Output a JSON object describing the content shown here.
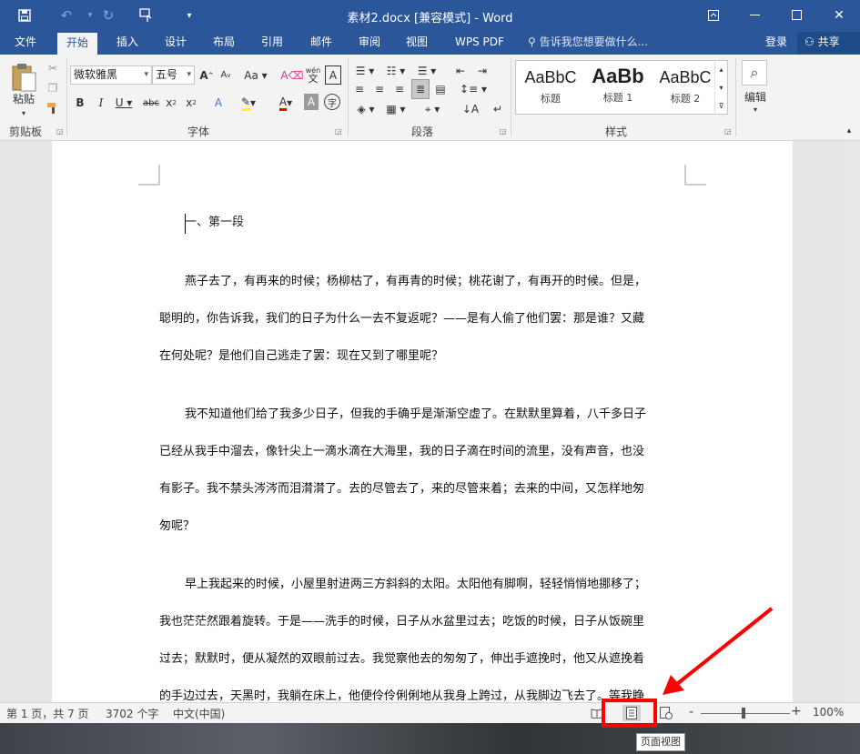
{
  "window": {
    "title": "素材2.docx [兼容模式] - Word"
  },
  "tabs": [
    "文件",
    "开始",
    "插入",
    "设计",
    "布局",
    "引用",
    "邮件",
    "审阅",
    "视图",
    "WPS PDF"
  ],
  "tell_me": "告诉我您想要做什么...",
  "account": {
    "login": "登录",
    "share": "共享"
  },
  "ribbon": {
    "clipboard": {
      "paste": "粘贴",
      "label": "剪贴板"
    },
    "font": {
      "name": "微软雅黑",
      "size": "五号",
      "label": "字体",
      "wen": "wén",
      "A": "A"
    },
    "paragraph": {
      "label": "段落"
    },
    "styles": {
      "label": "样式",
      "items": [
        {
          "sample": "AaBbC",
          "name": "标题"
        },
        {
          "sample": "AaBb",
          "name": "标题 1"
        },
        {
          "sample": "AaBbC",
          "name": "标题 2"
        }
      ]
    },
    "editing": {
      "label": "编辑"
    }
  },
  "document": {
    "heading": "一、第一段",
    "paragraphs": [
      [
        "燕子去了，有再来的时候；杨柳枯了，有再青的时候；桃花谢了，有再开的时候。但是，",
        "聪明的，你告诉我，我们的日子为什么一去不复返呢？——是有人偷了他们罢：那是谁？又藏",
        "在何处呢？是他们自己逃走了罢：现在又到了哪里呢？"
      ],
      [
        "我不知道他们给了我多少日子，但我的手确乎是渐渐空虚了。在默默里算着，八千多日子",
        "已经从我手中溜去，像针尖上一滴水滴在大海里，我的日子滴在时间的流里，没有声音，也没",
        "有影子。我不禁头涔涔而泪潸潸了。去的尽管去了，来的尽管来着；去来的中间，又怎样地匆",
        "匆呢？"
      ],
      [
        "早上我起来的时候，小屋里射进两三方斜斜的太阳。太阳他有脚啊，轻轻悄悄地挪移了；",
        "我也茫茫然跟着旋转。于是——洗手的时候，日子从水盆里过去；吃饭的时候，日子从饭碗里",
        "过去；默默时，便从凝然的双眼前过去。我觉察他去的匆匆了，伸出手遮挽时，他又从遮挽着",
        "的手边过去，天黑时，我躺在床上，他便伶伶俐俐地从我身上跨过，从我脚边飞去了。等我睁"
      ]
    ]
  },
  "status": {
    "page": "第 1 页，共 7 页",
    "words": "3702 个字",
    "language": "中文(中国)",
    "zoom": "100%",
    "zoom_minus": "-",
    "zoom_plus": "+"
  },
  "tooltip": "页面视图",
  "colors": {
    "accent": "#2b579a",
    "highlight": "#ff0000"
  }
}
